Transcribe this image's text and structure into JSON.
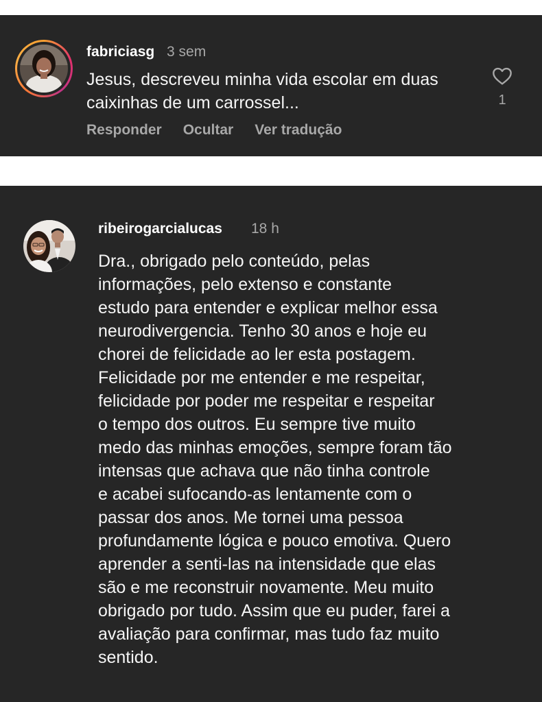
{
  "comments": [
    {
      "username": "fabriciasg",
      "time": "3 sem",
      "text": "Jesus, descreveu minha vida escolar em duas\ncaixinhas de um carrossel...",
      "likes": "1",
      "actions": [
        "Responder",
        "Ocultar",
        "Ver tradução"
      ]
    },
    {
      "username": "ribeirogarcialucas",
      "time": "18 h",
      "text": "Dra., obrigado pelo conteúdo, pelas\ninformações, pelo extenso e constante\nestudo para entender e explicar melhor essa\nneurodivergencia. Tenho 30 anos e hoje eu\nchorei de felicidade ao ler esta postagem.\nFelicidade por me entender e me respeitar,\nfelicidade por poder me respeitar e respeitar\no tempo dos outros. Eu sempre tive muito\nmedo das minhas emoções, sempre foram tão\nintensas que achava que não tinha controle\ne acabei sufocando-as lentamente com o\npassar dos anos. Me tornei uma pessoa\nprofundamente lógica e pouco emotiva. Quero\naprender a senti-las na intensidade que elas\nsão e me reconstruir novamente. Meu muito\nobrigado por tudo. Assim que eu puder, farei a\navaliação para confirmar, mas tudo faz muito\nsentido."
    }
  ],
  "icons": {
    "like": "heart-outline-icon"
  },
  "colors": {
    "card_bg": "#262626",
    "muted": "#a8a8a8",
    "story_ring": "#e1306c"
  }
}
